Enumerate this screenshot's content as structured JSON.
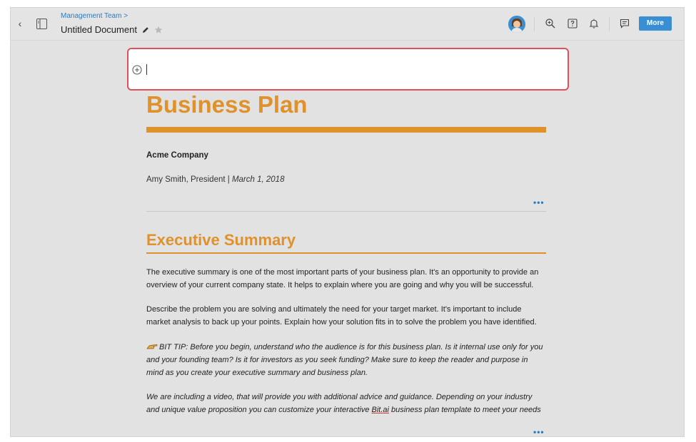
{
  "header": {
    "breadcrumb": "Management Team >",
    "doc_title": "Untitled Document",
    "more_label": "More",
    "icons": [
      "back-icon",
      "sidebar-toggle-icon",
      "pencil-icon",
      "star-icon",
      "avatar",
      "zoom-in-icon",
      "help-icon",
      "bell-icon",
      "comment-icon"
    ]
  },
  "editor": {
    "input_icon": "plus-circle-icon"
  },
  "document": {
    "title": "Business Plan",
    "company": "Acme Company",
    "author": "Amy Smith, President | ",
    "date": "March 1, 2018",
    "more_dots": "•••",
    "section_heading": "Executive Summary",
    "para1": "The executive summary is one of the most important parts of your business plan. It's an opportunity to provide an overview of your current company state. It helps to explain where you are going and why you will be successful.",
    "para2": "Describe the problem you are solving and ultimately the need for your target market. It's important to include market analysis to back up your points. Explain how your solution fits in to solve the problem you have identified.",
    "tip": "BIT TIP: Before you begin, understand who the audience is for this business plan. Is it internal use only for you and your founding team? Is it for investors as you seek funding? Make sure to keep the reader and purpose in mind as you create your executive summary and business plan.",
    "video_pre": "We are including a video, that will provide you with additional advice and guidance. Depending on your industry and unique value proposition you can customize your interactive ",
    "video_link": "Bit.ai",
    "video_post": " business plan template to meet your needs"
  },
  "colors": {
    "accent_orange": "#e0912a",
    "brand_blue": "#3a8fd4",
    "focus_red": "#e0505b"
  }
}
